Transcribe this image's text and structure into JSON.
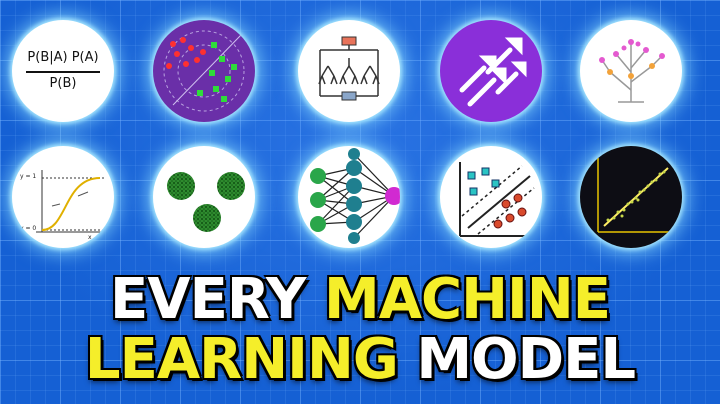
{
  "thumbnail": {
    "headline_line1": {
      "part1": "EVERY",
      "part2": "MACHINE"
    },
    "headline_line2": {
      "part1": "LEARNING",
      "part2": "MODEL"
    },
    "colors": {
      "accent_yellow": "#f5ee2a",
      "background_blue": "#1560d4",
      "glow": "#8cdcff"
    },
    "icons": {
      "bayes": {
        "name": "bayes-formula-icon",
        "numerator": "P(B|A) P(A)",
        "denominator": "P(B)"
      },
      "clustering_scatter": {
        "name": "clustering-scatter-icon"
      },
      "decision_tree": {
        "name": "decision-tree-icon"
      },
      "boosting": {
        "name": "boosting-arrows-icon"
      },
      "random_forest": {
        "name": "tree-icon"
      },
      "logistic": {
        "name": "logistic-curve-icon",
        "y1": "y = 1",
        "y0": "y = 0",
        "xlabel": "x"
      },
      "kmeans": {
        "name": "kmeans-clusters-icon"
      },
      "neural_net": {
        "name": "neural-network-icon"
      },
      "svm": {
        "name": "svm-margin-icon"
      },
      "linear_regression": {
        "name": "linear-regression-icon"
      }
    }
  }
}
